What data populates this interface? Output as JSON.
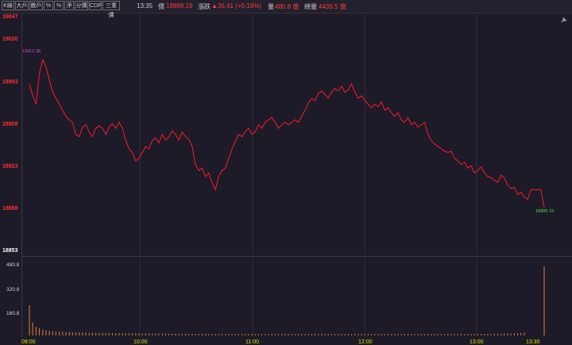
{
  "toolbar": {
    "buttons": [
      "K線",
      "大戶",
      "散戶",
      "%",
      "%",
      "淨",
      "分價",
      "CDP",
      "三重價"
    ]
  },
  "header": {
    "time": "13:35",
    "price_label": "價",
    "price_value": "18889.19",
    "change_label": "漲跌",
    "change_value": "▲36.41 (+0.19%)",
    "volume_label": "量",
    "volume_value": "480.8 億",
    "total_volume_label": "總量",
    "total_volume_value": "4439.5 億"
  },
  "price_axis": {
    "labels": [
      "19047",
      "19020",
      "18993",
      "18958",
      "18923",
      "18888",
      "18853"
    ]
  },
  "volume_axis": {
    "labels": [
      "480.8",
      "320.8",
      "160.8"
    ]
  },
  "time_axis": {
    "labels": [
      "09:00",
      "10:00",
      "11:00",
      "12:00",
      "13:00",
      "13:30"
    ]
  },
  "annotations": {
    "high": "19012.38",
    "last": "18889.19"
  },
  "tool_icon": "wrench-icon",
  "colors": {
    "background": "#1d1b27",
    "price_line": "#e8192c",
    "volume_bar": "#c0703c",
    "up": "#ff3b3b",
    "axis_time": "#e0e000",
    "last_price": "#44dd44"
  },
  "chart_data": {
    "type": "line",
    "title": "",
    "xlabel": "",
    "ylabel": "",
    "ylim": [
      18853,
      19047
    ],
    "x_range": [
      "09:00",
      "13:30"
    ],
    "series": [
      {
        "values": [
          18992,
          18982,
          18975,
          19000,
          19012,
          19006,
          18995,
          18985,
          18980,
          18975,
          18970,
          18965,
          18962,
          18960,
          18950,
          18948,
          18956,
          18958,
          18952,
          18948,
          18955,
          18957,
          18955,
          18950,
          18956,
          18959,
          18955,
          18960,
          18955,
          18945,
          18938,
          18935,
          18928,
          18930,
          18935,
          18940,
          18938,
          18945,
          18947,
          18943,
          18950,
          18945,
          18948,
          18953,
          18950,
          18945,
          18952,
          18948,
          18946,
          18940,
          18925,
          18920,
          18922,
          18915,
          18918,
          18910,
          18904,
          18915,
          18920,
          18922,
          18930,
          18938,
          18944,
          18950,
          18948,
          18952,
          18955,
          18950,
          18952,
          18958,
          18955,
          18960,
          18962,
          18964,
          18960,
          18955,
          18958,
          18960,
          18958,
          18960,
          18962,
          18960,
          18965,
          18970,
          18976,
          18980,
          18978,
          18984,
          18986,
          18983,
          18980,
          18985,
          18988,
          18986,
          18990,
          18985,
          18987,
          18992,
          18985,
          18980,
          18982,
          18978,
          18975,
          18972,
          18975,
          18973,
          18977,
          18970,
          18972,
          18968,
          18965,
          18968,
          18962,
          18960,
          18964,
          18958,
          18960,
          18956,
          18958,
          18960,
          18950,
          18945,
          18942,
          18940,
          18938,
          18936,
          18935,
          18936,
          18930,
          18928,
          18925,
          18927,
          18922,
          18924,
          18918,
          18920,
          18923,
          18918,
          18915,
          18914,
          18912,
          18910,
          18916,
          18914,
          18908,
          18905,
          18906,
          18900,
          18902,
          18898,
          18896,
          18904,
          18904,
          18904,
          18904,
          18889.19
        ],
        "color": "#e8192c"
      }
    ],
    "volume_series": {
      "ylim": [
        0,
        480.8
      ],
      "values": [
        210,
        90,
        60,
        50,
        40,
        35,
        32,
        30,
        28,
        26,
        25,
        24,
        23,
        22,
        22,
        21,
        20,
        20,
        19,
        19,
        18,
        18,
        18,
        17,
        17,
        17,
        16,
        16,
        16,
        15,
        15,
        15,
        15,
        14,
        14,
        14,
        14,
        13,
        13,
        13,
        13,
        13,
        12,
        12,
        12,
        12,
        12,
        12,
        11,
        11,
        11,
        11,
        11,
        11,
        11,
        10,
        10,
        10,
        10,
        10,
        10,
        10,
        10,
        10,
        10,
        10,
        10,
        10,
        10,
        10,
        10,
        10,
        10,
        10,
        10,
        10,
        10,
        10,
        10,
        10,
        10,
        10,
        10,
        10,
        10,
        10,
        10,
        10,
        10,
        10,
        10,
        10,
        10,
        10,
        10,
        10,
        10,
        10,
        10,
        10,
        10,
        10,
        10,
        10,
        10,
        10,
        10,
        10,
        10,
        10,
        10,
        10,
        10,
        10,
        10,
        10,
        10,
        10,
        10,
        10,
        10,
        10,
        10,
        10,
        10,
        10,
        10,
        10,
        10,
        10,
        10,
        10,
        10,
        10,
        10,
        10,
        11,
        11,
        11,
        11,
        12,
        12,
        12,
        13,
        13,
        14,
        15,
        16,
        18,
        20,
        0,
        0,
        0,
        0,
        0,
        480.8
      ]
    }
  }
}
